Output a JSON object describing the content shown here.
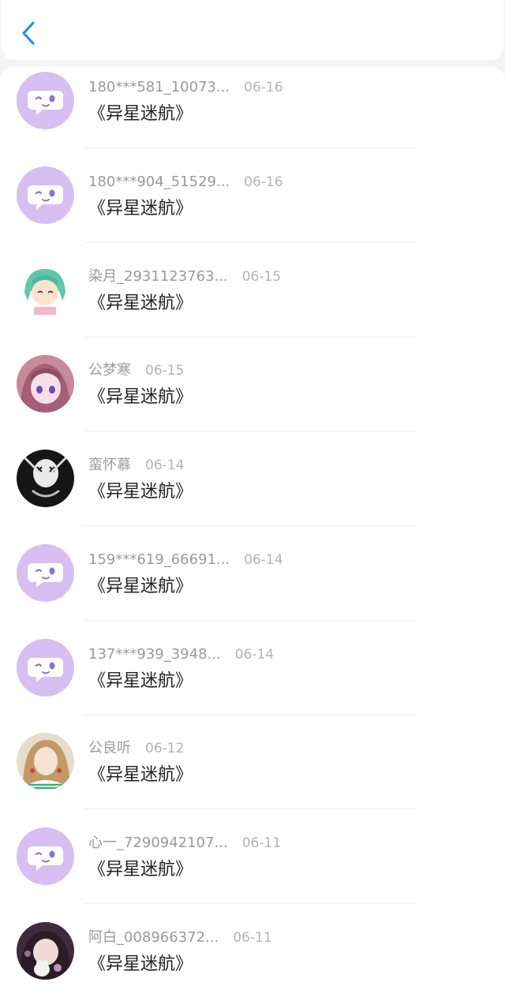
{
  "colors": {
    "accent": "#2e8ff0",
    "default_avatar_bg": "#d7bff2",
    "default_avatar_fg": "#ffffff",
    "default_avatar_dot": "#8b6fd6"
  },
  "header": {
    "back_icon": "chevron-left-icon"
  },
  "rows": [
    {
      "name": "180***581_10073...",
      "date": "06-16",
      "title": "《异星迷航》",
      "avatar": "default"
    },
    {
      "name": "180***904_51529...",
      "date": "06-16",
      "title": "《异星迷航》",
      "avatar": "default"
    },
    {
      "name": "染月_2931123763...",
      "date": "06-15",
      "title": "《异星迷航》",
      "avatar": "anime-green"
    },
    {
      "name": "公梦寒",
      "date": "06-15",
      "title": "《异星迷航》",
      "avatar": "anime-pink"
    },
    {
      "name": "蛮怀慕",
      "date": "06-14",
      "title": "《异星迷航》",
      "avatar": "dark"
    },
    {
      "name": "159***619_66691...",
      "date": "06-14",
      "title": "《异星迷航》",
      "avatar": "default"
    },
    {
      "name": "137***939_3948...",
      "date": "06-14",
      "title": "《异星迷航》",
      "avatar": "default"
    },
    {
      "name": "公良听",
      "date": "06-12",
      "title": "《异星迷航》",
      "avatar": "photo"
    },
    {
      "name": "心一_7290942107...",
      "date": "06-11",
      "title": "《异星迷航》",
      "avatar": "default"
    },
    {
      "name": "阿白_008966372...",
      "date": "06-11",
      "title": "《异星迷航》",
      "avatar": "anime-purple"
    }
  ]
}
